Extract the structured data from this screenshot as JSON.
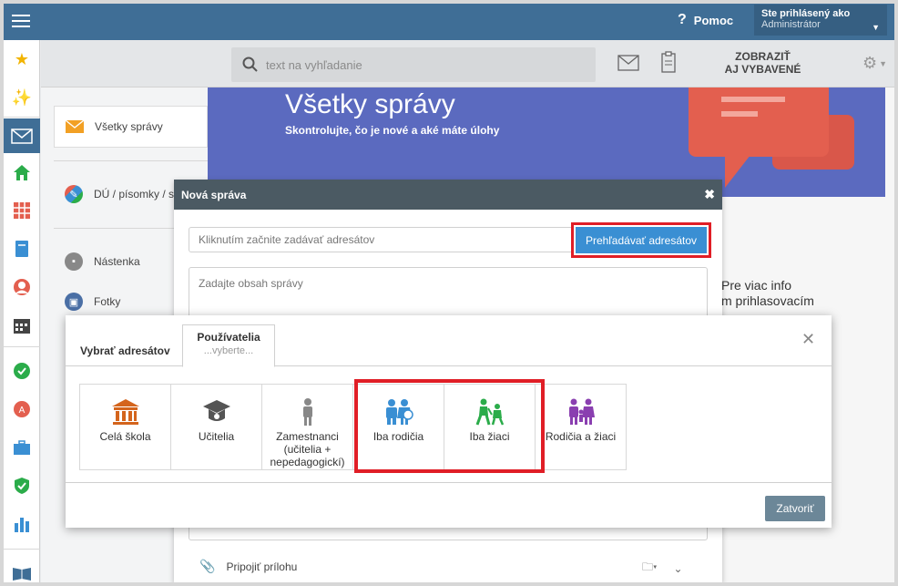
{
  "topbar": {
    "help_label": "Pomoc",
    "user_label": "Ste prihlásený ako",
    "user_name": "Administrátor"
  },
  "toolbar": {
    "search_placeholder": "text na vyhľadanie",
    "show_label_1": "ZOBRAZIŤ",
    "show_label_2": "AJ VYBAVENÉ"
  },
  "nav": {
    "items": [
      {
        "label": "Všetky správy"
      },
      {
        "label": "DÚ / písomky / s"
      },
      {
        "label": "Nástenka"
      },
      {
        "label": "Fotky"
      }
    ]
  },
  "hero": {
    "title": "Všetky správy",
    "subtitle": "Skontrolujte, čo je nové a aké máte úlohy"
  },
  "side_text": {
    "line1": "Pre viac info",
    "line2": "m prihlasovacím"
  },
  "new_message": {
    "title": "Nová správa",
    "recipients_placeholder": "Kliknutím začnite zadávať adresátov",
    "browse_button": "Prehľadávať adresátov",
    "body_placeholder": "Zadajte obsah správy",
    "attach_label": "Pripojiť prílohu"
  },
  "picker": {
    "title": "Vybrať adresátov",
    "tab_title": "Používatelia",
    "tab_subtitle": "...vyberte...",
    "tiles": [
      {
        "label": "Celá škola",
        "icon": "school-building-icon",
        "color": "#d4641c"
      },
      {
        "label": "Učitelia",
        "icon": "graduation-cap-icon",
        "color": "#555555"
      },
      {
        "label": "Zamestnanci (učitelia + nepedagogickí)",
        "icon": "employee-icon",
        "color": "#888888"
      },
      {
        "label": "Iba rodičia",
        "icon": "parents-icon",
        "color": "#3a8fd3"
      },
      {
        "label": "Iba žiaci",
        "icon": "students-icon",
        "color": "#2bac4a"
      },
      {
        "label": "Rodičia a žiaci",
        "icon": "parents-and-students-icon",
        "color": "#8a3fb0"
      }
    ],
    "close_button": "Zatvoriť"
  },
  "colors": {
    "topbar": "#3f6e96",
    "hero": "#5b6abf",
    "highlight": "#e01e26",
    "browse_button": "#3a8fd3",
    "close_button": "#6c8798"
  }
}
